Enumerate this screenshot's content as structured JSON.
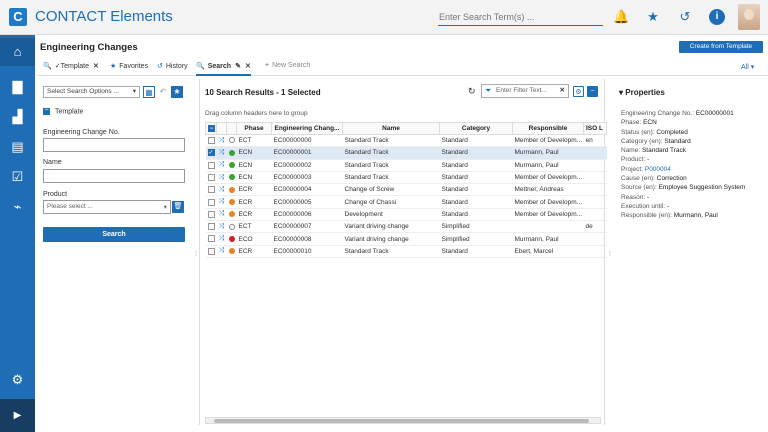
{
  "header": {
    "app_title": "CONTACT Elements",
    "logo_letter": "C",
    "search_placeholder": "Enter Search Term(s) ...",
    "icons": [
      "bell-icon",
      "star-icon",
      "history-icon",
      "info-icon"
    ]
  },
  "sidebar": {
    "items": [
      "home-icon",
      "document-icon",
      "steps-icon",
      "card-icon",
      "check-icon",
      "pulse-icon"
    ],
    "bottom": [
      "gear-icon",
      "expand-icon"
    ]
  },
  "page": {
    "title": "Engineering Changes",
    "create_from_template": "Create from Template",
    "tabs": [
      {
        "label": "Template",
        "icon": "search-icon",
        "closable": true
      },
      {
        "label": "Favorites",
        "icon": "star-icon",
        "closable": false
      },
      {
        "label": "History",
        "icon": "history-icon",
        "closable": false
      },
      {
        "label": "Search",
        "icon": "search-icon",
        "closable": true,
        "active": true
      },
      {
        "label": "New Search",
        "icon": "plus-icon",
        "closable": false
      }
    ],
    "all_label": "All"
  },
  "search_form": {
    "select_options": "Select Search Options ...",
    "section_title": "Template",
    "fields": [
      {
        "label": "Engineering Change No.",
        "value": ""
      },
      {
        "label": "Name",
        "value": ""
      }
    ],
    "product_label": "Product",
    "product_placeholder": "Please select ...",
    "search_button": "Search"
  },
  "results": {
    "title": "10 Search Results - 1 Selected",
    "filter_placeholder": "Enter Filter Text...",
    "drag_hint": "Drag column headers here to group",
    "columns": [
      "Phase",
      "Engineering Chang...",
      "Name",
      "Category",
      "Responsible",
      "ISO L"
    ],
    "rows": [
      {
        "phase": "ECT",
        "dot": "#ffffff",
        "id": "EC00000000",
        "name": "Standard Track",
        "category": "Standard",
        "responsible": "Member of Developm...",
        "iso": "en",
        "selected": false
      },
      {
        "phase": "ECN",
        "dot": "#3aa335",
        "id": "EC00000001",
        "name": "Standard Track",
        "category": "Standard",
        "responsible": "Murmann, Paul",
        "iso": "",
        "selected": true
      },
      {
        "phase": "ECN",
        "dot": "#3aa335",
        "id": "EC00000002",
        "name": "Standard Track",
        "category": "Standard",
        "responsible": "Murmann, Paul",
        "iso": "",
        "selected": false
      },
      {
        "phase": "ECN",
        "dot": "#3aa335",
        "id": "EC00000003",
        "name": "Standard Track",
        "category": "Standard",
        "responsible": "Member of Developm...",
        "iso": "",
        "selected": false
      },
      {
        "phase": "ECR",
        "dot": "#e8822a",
        "id": "EC00000004",
        "name": "Change of Screw",
        "category": "Standard",
        "responsible": "Mettner, Andreas",
        "iso": "",
        "selected": false
      },
      {
        "phase": "ECR",
        "dot": "#e8822a",
        "id": "EC00000005",
        "name": "Change of Chassi",
        "category": "Standard",
        "responsible": "Member of Developm...",
        "iso": "",
        "selected": false
      },
      {
        "phase": "ECR",
        "dot": "#e8822a",
        "id": "EC00000006",
        "name": "Development",
        "category": "Standard",
        "responsible": "Member of Developm...",
        "iso": "",
        "selected": false
      },
      {
        "phase": "ECT",
        "dot": "#ffffff",
        "id": "EC00000007",
        "name": "Variant driving change",
        "category": "Simplified",
        "responsible": "",
        "iso": "de",
        "selected": false
      },
      {
        "phase": "ECO",
        "dot": "#d42020",
        "id": "EC00000008",
        "name": "Variant driving change",
        "category": "Simplified",
        "responsible": "Murmann, Paul",
        "iso": "",
        "selected": false
      },
      {
        "phase": "ECR",
        "dot": "#e8822a",
        "id": "EC00000010",
        "name": "Standard Track",
        "category": "Standard",
        "responsible": "Ebert, Marcel",
        "iso": "",
        "selected": false
      }
    ]
  },
  "properties": {
    "title": "Properties",
    "items": [
      {
        "label": "Engineering Change No.:",
        "value": "EC00000001",
        "link": false
      },
      {
        "label": "Phase:",
        "value": "ECN",
        "link": false
      },
      {
        "label": "Status (en):",
        "value": "Completed",
        "link": false
      },
      {
        "label": "Category (en):",
        "value": "Standard",
        "link": false
      },
      {
        "label": "Name:",
        "value": "Standard Track",
        "link": false
      },
      {
        "label": "Product:",
        "value": "-",
        "link": false
      },
      {
        "label": "Project:",
        "value": "P000004",
        "link": true
      },
      {
        "label": "Cause (en):",
        "value": "Correction",
        "link": false
      },
      {
        "label": "Source (en):",
        "value": "Employee Suggestion System",
        "link": false
      },
      {
        "label": "Reason:",
        "value": "-",
        "link": false
      },
      {
        "label": "Execution until:",
        "value": "-",
        "link": false
      },
      {
        "label": "Responsible (en):",
        "value": "Murmann, Paul",
        "link": false
      }
    ]
  }
}
